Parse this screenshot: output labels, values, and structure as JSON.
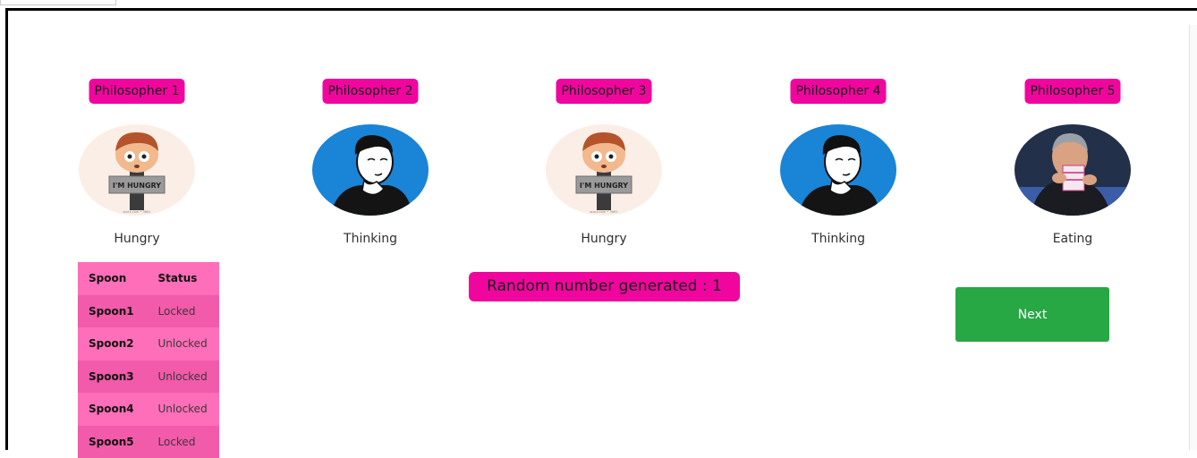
{
  "philosophers": [
    {
      "label": "Philosopher 1",
      "state": "Hungry",
      "image": "hungry-boy-icon"
    },
    {
      "label": "Philosopher 2",
      "state": "Thinking",
      "image": "thinking-man-icon"
    },
    {
      "label": "Philosopher 3",
      "state": "Hungry",
      "image": "hungry-boy-icon"
    },
    {
      "label": "Philosopher 4",
      "state": "Thinking",
      "image": "thinking-man-icon"
    },
    {
      "label": "Philosopher 5",
      "state": "Eating",
      "image": "eating-man-icon"
    }
  ],
  "avatar_text": {
    "hungry_sign": "I'M HUNGRY",
    "hungry_caption": "stock.com • 3861"
  },
  "spoon_table": {
    "headers": [
      "Spoon",
      "Status"
    ],
    "rows": [
      {
        "spoon": "Spoon1",
        "status": "Locked"
      },
      {
        "spoon": "Spoon2",
        "status": "Unlocked"
      },
      {
        "spoon": "Spoon3",
        "status": "Unlocked"
      },
      {
        "spoon": "Spoon4",
        "status": "Unlocked"
      },
      {
        "spoon": "Spoon5",
        "status": "Locked"
      }
    ]
  },
  "random_label": "Random number generated : 1",
  "next_label": "Next",
  "colors": {
    "label_pink": "#f0069e",
    "table_light": "#ff6eb8",
    "table_dark": "#f25aaa",
    "next_green": "#28a745"
  }
}
